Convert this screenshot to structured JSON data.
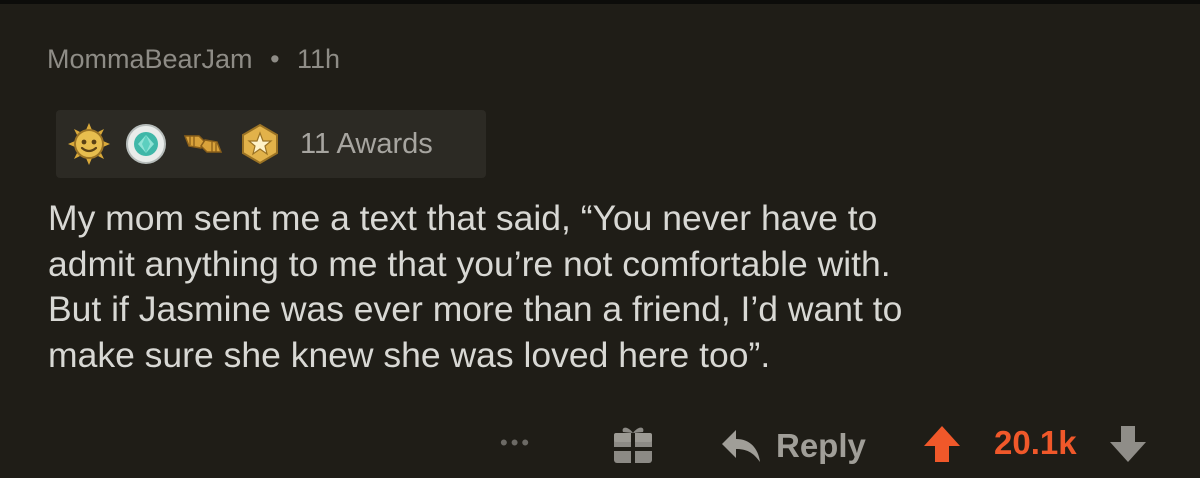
{
  "comment": {
    "author": "MommaBearJam",
    "separator": "•",
    "age": "11h",
    "awards": {
      "icons": [
        "sun-award-icon",
        "gem-award-icon",
        "fist-bump-award-icon",
        "star-badge-award-icon"
      ],
      "count_label": "11 Awards"
    },
    "text": "My mom sent me a text that said, “You never have to\nadmit anything to me that you’re not comfortable with.\nBut if Jasmine was ever more than a friend, I’d want to\nmake sure she knew she was loved here too”."
  },
  "actions": {
    "more_label": "•••",
    "gift_icon": "gift-icon",
    "reply_label": "Reply",
    "reply_icon": "reply-arrow-icon",
    "upvote_icon": "upvote-arrow-icon",
    "score": "20.1k",
    "downvote_icon": "downvote-arrow-icon"
  },
  "colors": {
    "background": "#1f1d17",
    "award_bar": "#2c2a24",
    "upvote_active": "#f0582a",
    "muted_text": "#8e8c86"
  }
}
